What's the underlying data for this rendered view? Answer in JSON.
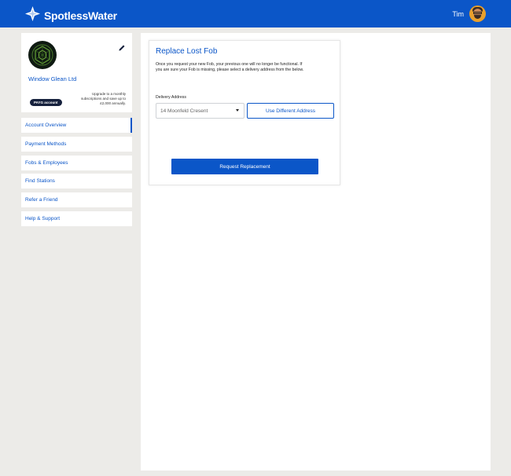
{
  "header": {
    "brand": "SpotlessWater",
    "logo_icon": "sparkle-star-icon",
    "user_name": "Tim",
    "brand_color": "#0b56c8"
  },
  "profile": {
    "org_name": "Window Glean Ltd",
    "account_badge": "PAYG account",
    "upgrade_text": "Upgrade to a monthly subscriptions and save up to £2,000 annually.",
    "edit_icon": "pencil-icon"
  },
  "nav": {
    "items": [
      {
        "label": "Account Overview",
        "active": true
      },
      {
        "label": "Payment Methods"
      },
      {
        "label": "Fobs & Employees"
      },
      {
        "label": "Find Stations"
      },
      {
        "label": "Refer a Friend"
      },
      {
        "label": "Help & Support"
      }
    ]
  },
  "card": {
    "title": "Replace Lost Fob",
    "description": "Once you request your new Fob, your previous one will no longer be functional. If you are sure your Fob is missing, please select a delivery address from the below.",
    "delivery_label": "Delivery Address",
    "address_selected": "14 Moonfeld Cresent",
    "use_different_address": "Use Different Address",
    "request_button": "Request Replacement"
  }
}
